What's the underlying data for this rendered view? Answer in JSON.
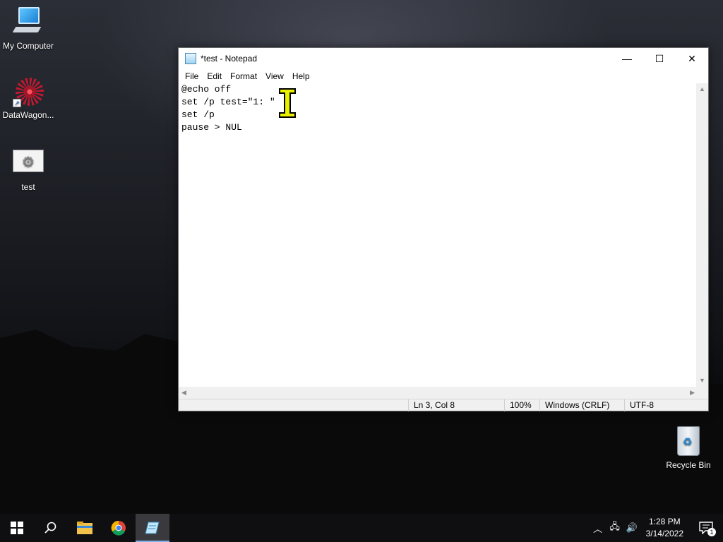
{
  "desktop": {
    "icons": [
      {
        "label": "My Computer",
        "icon": "computer-icon"
      },
      {
        "label": "DataWagon...",
        "icon": "datawagon-icon"
      },
      {
        "label": "test",
        "icon": "batch-file-icon"
      }
    ],
    "recycle_bin": {
      "label": "Recycle Bin",
      "icon": "recycle-bin-icon"
    }
  },
  "notepad": {
    "title": "*test - Notepad",
    "menu": [
      "File",
      "Edit",
      "Format",
      "View",
      "Help"
    ],
    "content": "@echo off\nset /p test=\"1: \"\nset /p \npause > NUL",
    "status": {
      "position": "Ln 3, Col 8",
      "zoom": "100%",
      "line_ending": "Windows (CRLF)",
      "encoding": "UTF-8"
    },
    "controls": {
      "minimize": "—",
      "maximize": "☐",
      "close": "✕"
    }
  },
  "taskbar": {
    "start_icon": "windows-start-icon",
    "search_icon": "search-icon",
    "pinned": [
      {
        "name": "file-explorer-icon"
      },
      {
        "name": "chrome-icon"
      },
      {
        "name": "notepad-icon",
        "active": true
      }
    ],
    "clock": {
      "time": "1:28 PM",
      "date": "3/14/2022"
    },
    "notifications_count": "1"
  }
}
